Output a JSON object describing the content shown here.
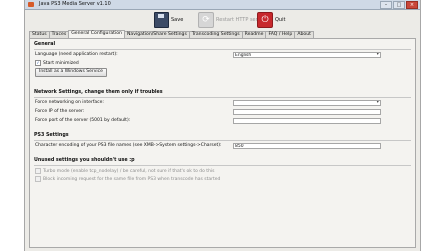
{
  "window": {
    "title": "Java PS3 Media Server v1.10",
    "controls": [
      "–",
      "□",
      "×"
    ]
  },
  "toolbar": {
    "save_label": "Save",
    "restart_label": "Restart HTTP server",
    "quit_label": "Quit"
  },
  "tabs": [
    {
      "label": "Status"
    },
    {
      "label": "Traces"
    },
    {
      "label": "General Configuration",
      "active": true
    },
    {
      "label": "Navigation/Share Settings"
    },
    {
      "label": "Transcoding Settings"
    },
    {
      "label": "Readme"
    },
    {
      "label": "FAQ / Help"
    },
    {
      "label": "About"
    }
  ],
  "general": {
    "title": "General",
    "language_label": "Language (need application restart):",
    "language_value": "English",
    "start_minimized": {
      "label": "Start minimized",
      "checked": true
    },
    "install_service_label": "Install as a Windows Service"
  },
  "network": {
    "title": "Network Settings, change them only if troubles",
    "force_interface_label": "Force networking on interface:",
    "force_interface_value": "",
    "force_ip_label": "Force IP of the server:",
    "force_ip_value": "",
    "force_port_label": "Force port of the server (5001 by default):",
    "force_port_value": ""
  },
  "ps3": {
    "title": "PS3 Settings",
    "charset_label": "Character encoding of your PS3 file names (see XMB->System settings->Charset):",
    "charset_value": "850"
  },
  "unused": {
    "title": "Unused settings you shouldn't use :p",
    "turbo": {
      "label": "Turbo mode (enable tcp_nodelay) / be careful, not sure if that's ok to do this",
      "checked": false
    },
    "block": {
      "label": "Block incoming request for the same file from PS3 when transcode has started",
      "checked": false
    }
  },
  "colors": {
    "quit": "#c7282c",
    "save": "#3c4b66",
    "check": "#1d4e9c"
  }
}
